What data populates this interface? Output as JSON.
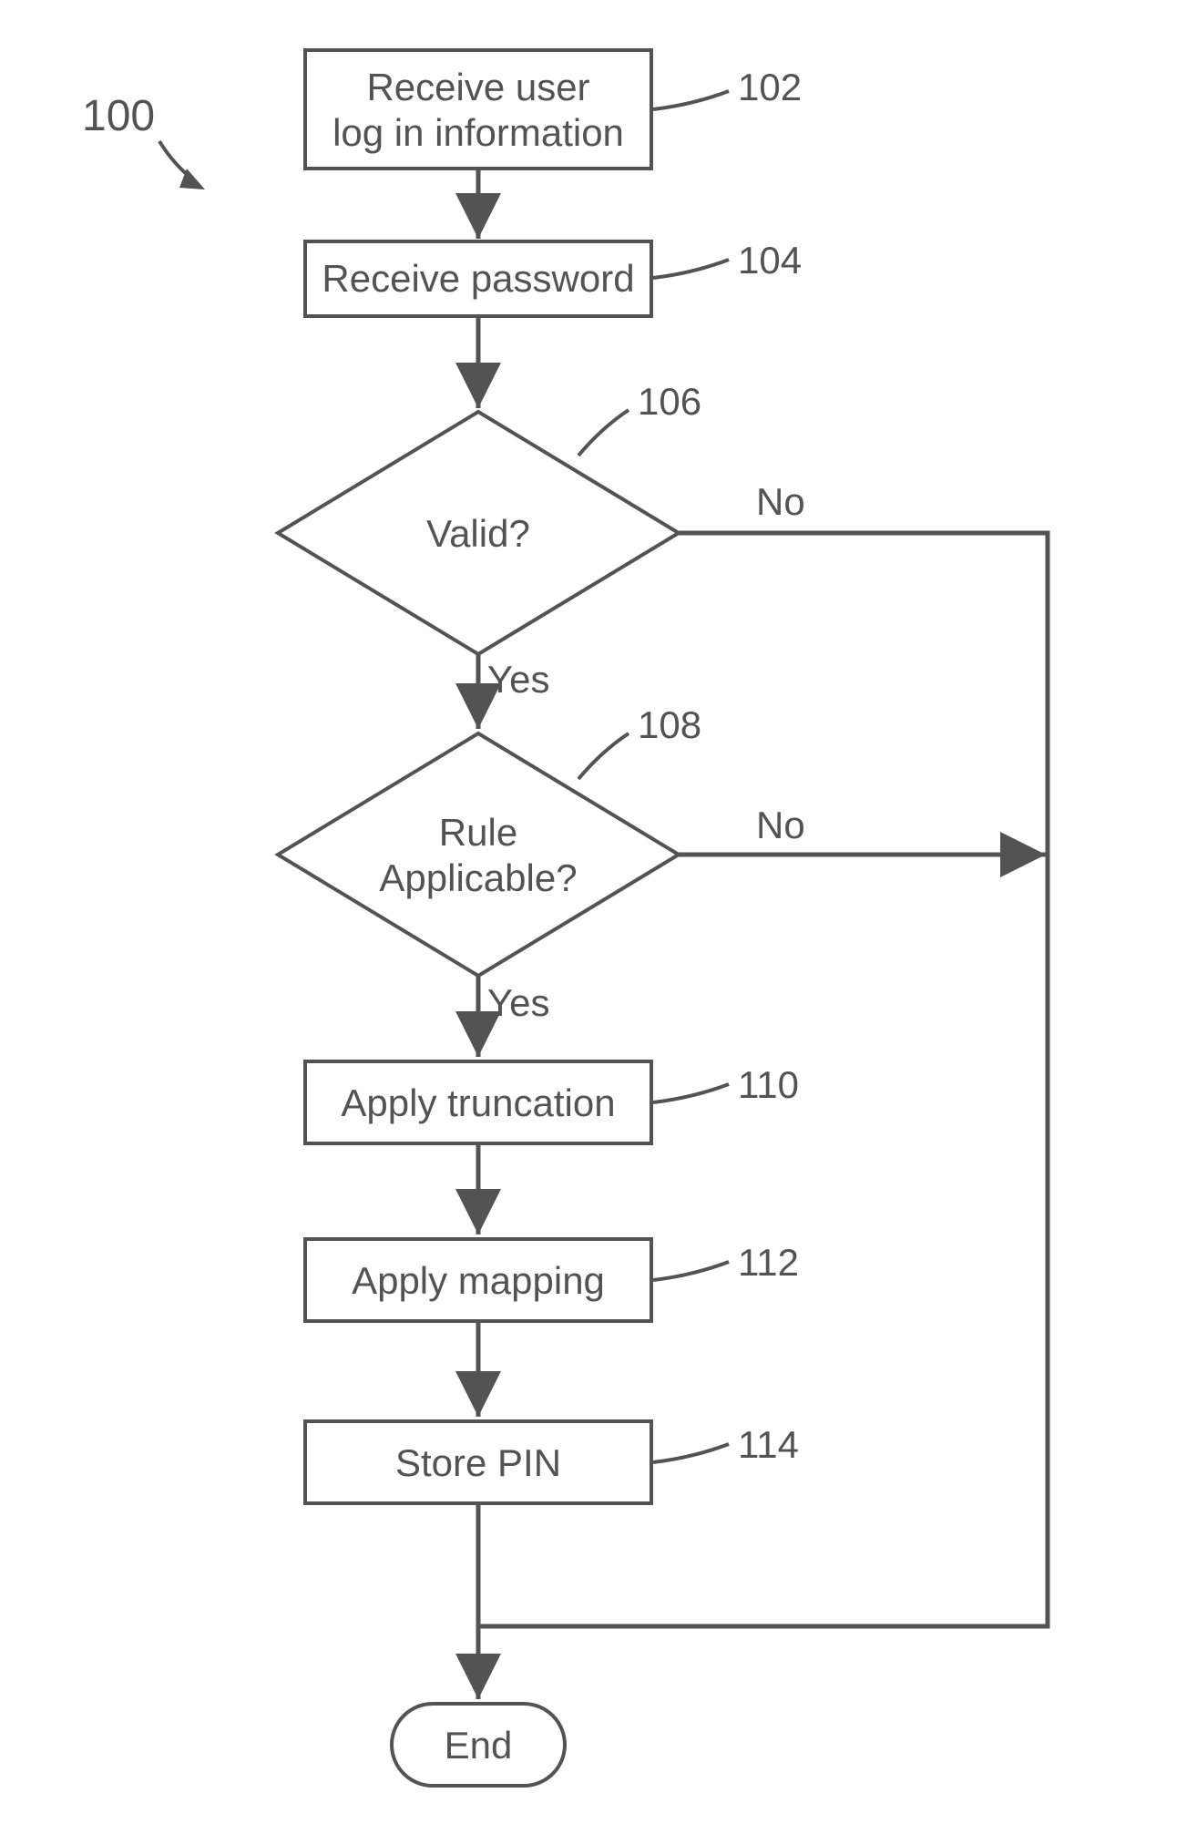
{
  "diagram": {
    "id_label": "100",
    "nodes": {
      "n102": {
        "text": [
          "Receive user",
          "log in information"
        ],
        "ref": "102"
      },
      "n104": {
        "text": [
          "Receive password"
        ],
        "ref": "104"
      },
      "n106": {
        "text": [
          "Valid?"
        ],
        "ref": "106",
        "yes": "Yes",
        "no": "No"
      },
      "n108": {
        "text": [
          "Rule",
          "Applicable?"
        ],
        "ref": "108",
        "yes": "Yes",
        "no": "No"
      },
      "n110": {
        "text": [
          "Apply truncation"
        ],
        "ref": "110"
      },
      "n112": {
        "text": [
          "Apply mapping"
        ],
        "ref": "112"
      },
      "n114": {
        "text": [
          "Store PIN"
        ],
        "ref": "114"
      },
      "end": {
        "text": [
          "End"
        ]
      }
    }
  }
}
